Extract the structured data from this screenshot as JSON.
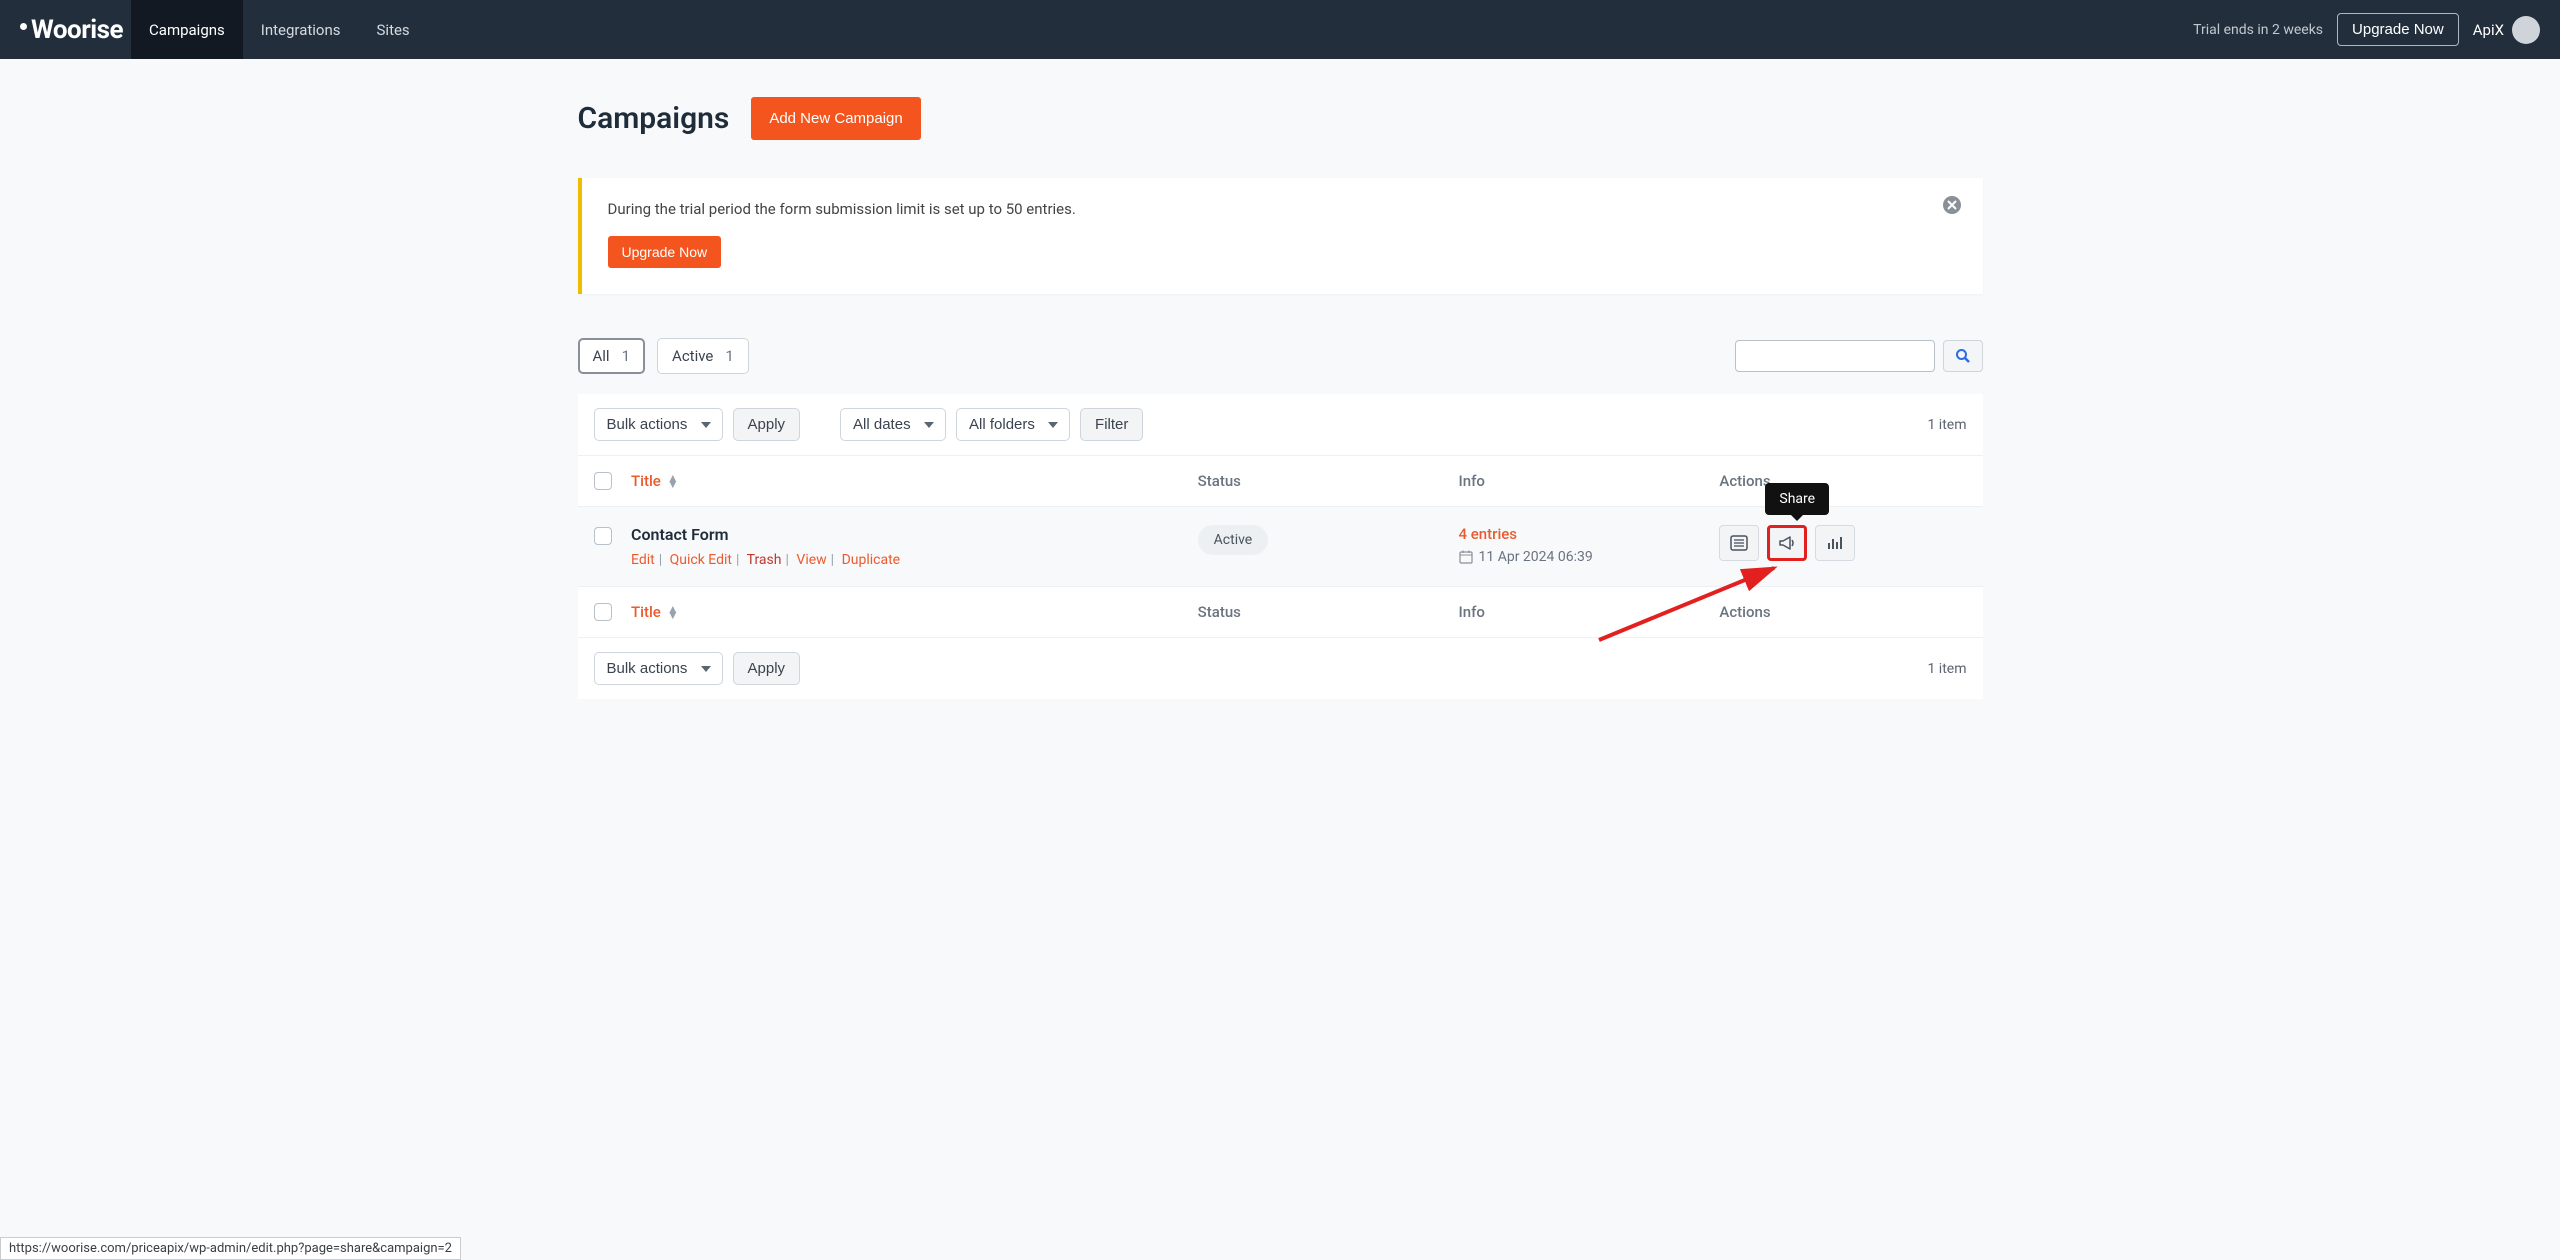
{
  "nav": {
    "logo": "Woorise",
    "items": [
      "Campaigns",
      "Integrations",
      "Sites"
    ],
    "active_index": 0,
    "trial_text": "Trial ends in 2 weeks",
    "upgrade_label": "Upgrade Now",
    "username": "ApiX"
  },
  "page": {
    "title": "Campaigns",
    "add_button": "Add New Campaign"
  },
  "notice": {
    "text": "During the trial period the form submission limit is set up to 50 entries.",
    "upgrade_label": "Upgrade Now"
  },
  "filters": {
    "tabs": [
      {
        "label": "All",
        "count": "1",
        "active": true
      },
      {
        "label": "Active",
        "count": "1",
        "active": false
      }
    ]
  },
  "toolbar": {
    "bulk_actions": "Bulk actions",
    "apply": "Apply",
    "all_dates": "All dates",
    "all_folders": "All folders",
    "filter": "Filter",
    "item_count": "1 item"
  },
  "table": {
    "headers": {
      "title": "Title",
      "status": "Status",
      "info": "Info",
      "actions": "Actions"
    },
    "row": {
      "title": "Contact Form",
      "actions": {
        "edit": "Edit",
        "quick_edit": "Quick Edit",
        "trash": "Trash",
        "view": "View",
        "duplicate": "Duplicate"
      },
      "status": "Active",
      "entries": "4 entries",
      "date": "11 Apr 2024 06:39"
    },
    "tooltip": "Share"
  },
  "statusbar": "https://woorise.com/priceapix/wp-admin/edit.php?page=share&campaign=2"
}
